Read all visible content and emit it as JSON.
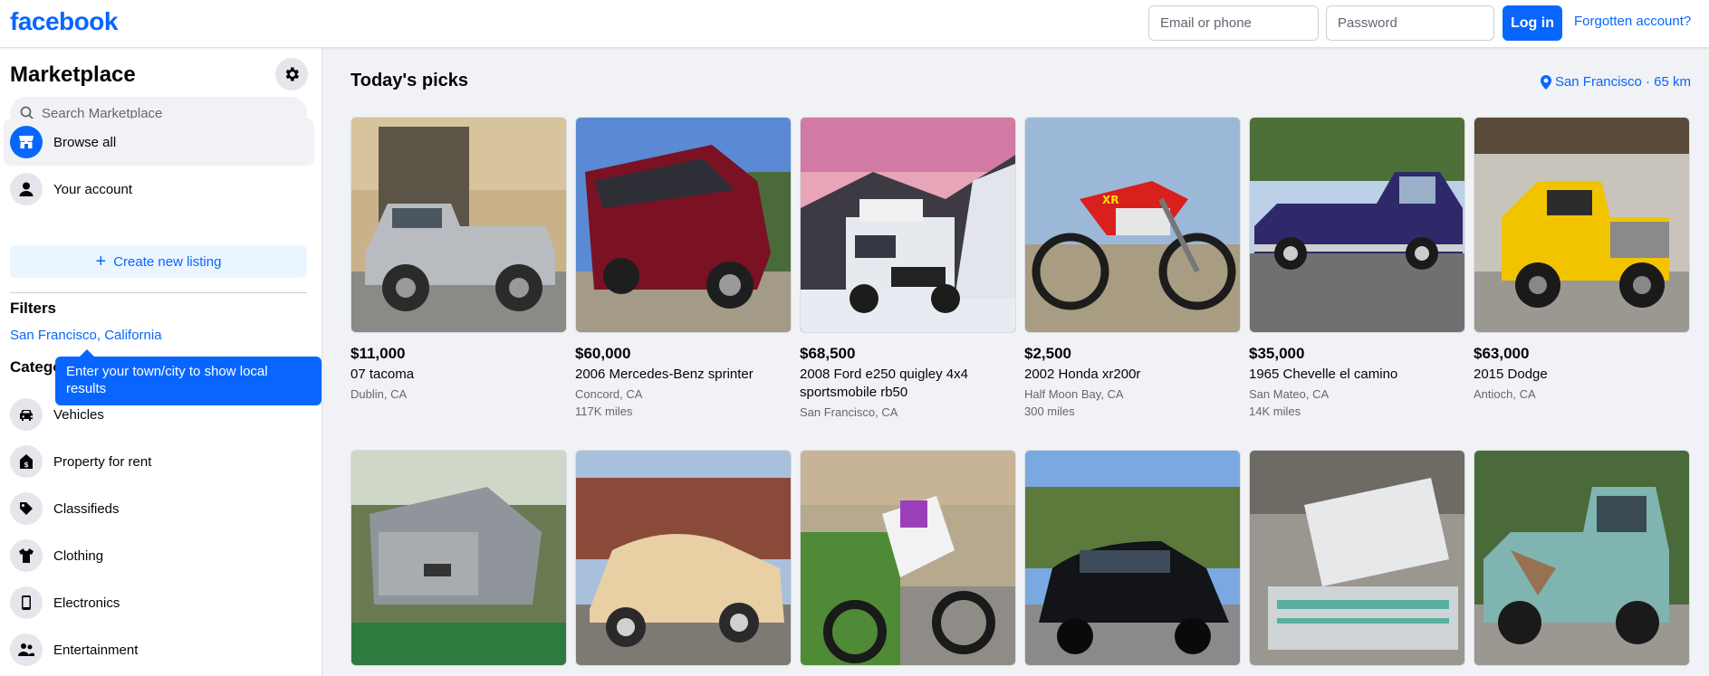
{
  "header": {
    "logo": "facebook",
    "email_placeholder": "Email or phone",
    "password_placeholder": "Password",
    "login_label": "Log in",
    "forgot_label": "Forgotten account?",
    "brand_color": "#0866ff"
  },
  "sidebar": {
    "title": "Marketplace",
    "search_placeholder": "Search Marketplace",
    "nav": [
      {
        "label": "Browse all",
        "icon": "storefront-icon",
        "active": true
      },
      {
        "label": "Your account",
        "icon": "user-icon",
        "active": false
      }
    ],
    "create_label": "Create new listing",
    "filters_heading": "Filters",
    "location_link": "San Francisco, California",
    "categories_heading": "Categories",
    "tooltip": "Enter your town/city to show local results",
    "categories": [
      {
        "label": "Vehicles",
        "icon": "car-icon"
      },
      {
        "label": "Property for rent",
        "icon": "house-icon"
      },
      {
        "label": "Classifieds",
        "icon": "tag-icon"
      },
      {
        "label": "Clothing",
        "icon": "shirt-icon"
      },
      {
        "label": "Electronics",
        "icon": "phone-icon"
      },
      {
        "label": "Entertainment",
        "icon": "people-icon"
      }
    ]
  },
  "main": {
    "title": "Today's picks",
    "location": "San Francisco · 65 km",
    "listings": [
      {
        "price": "$11,000",
        "name": "07 tacoma",
        "location": "Dublin, CA",
        "miles": ""
      },
      {
        "price": "$60,000",
        "name": "2006 Mercedes-Benz sprinter",
        "location": "Concord, CA",
        "miles": "117K miles"
      },
      {
        "price": "$68,500",
        "name": "2008 Ford e250 quigley 4x4 sportsmobile rb50",
        "location": "San Francisco, CA",
        "miles": ""
      },
      {
        "price": "$2,500",
        "name": "2002 Honda xr200r",
        "location": "Half Moon Bay, CA",
        "miles": "300 miles"
      },
      {
        "price": "$35,000",
        "name": "1965 Chevelle el camino",
        "location": "San Mateo, CA",
        "miles": "14K miles"
      },
      {
        "price": "$63,000",
        "name": "2015 Dodge",
        "location": "Antioch, CA",
        "miles": ""
      }
    ]
  }
}
